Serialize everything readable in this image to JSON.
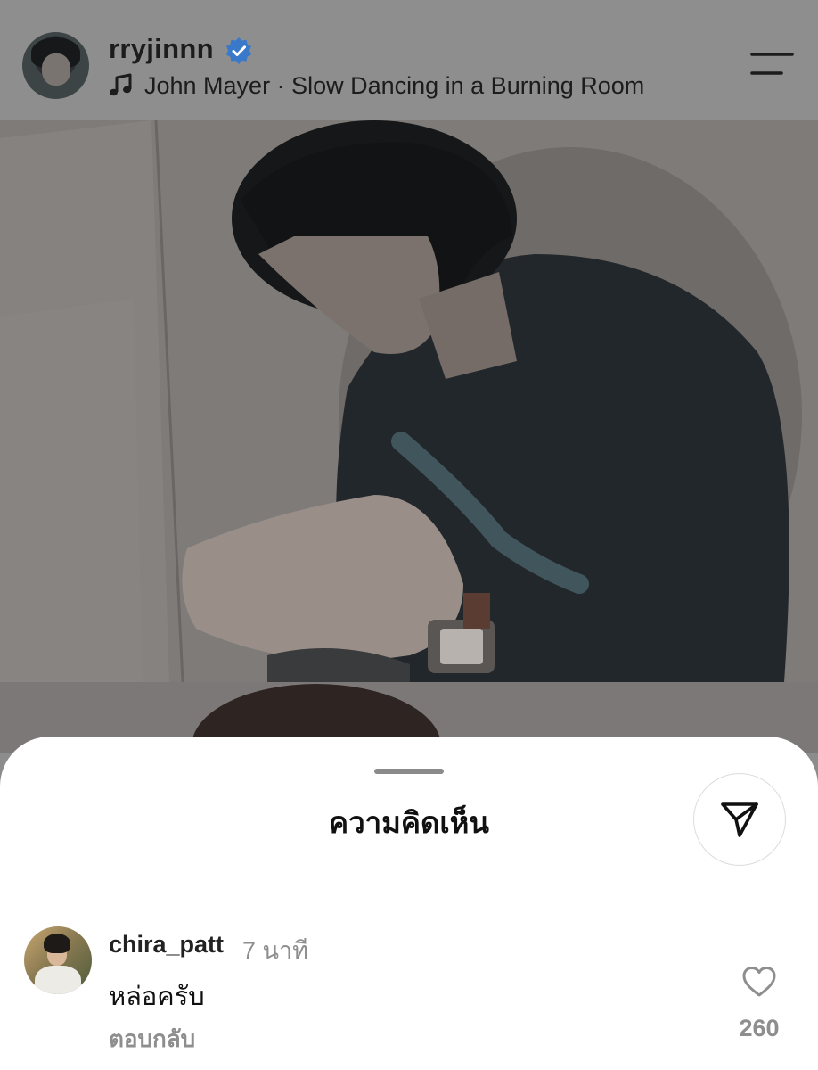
{
  "post_header": {
    "username": "rryjinnn",
    "verified_icon": "verified-badge-icon",
    "music_icon": "music-note-icon",
    "song": "John Mayer · Slow Dancing in a Burning Room",
    "menu_icon": "menu-icon"
  },
  "comments_sheet": {
    "title": "ความคิดเห็น",
    "share_icon": "send-icon",
    "comments": [
      {
        "username": "chira_patt",
        "time": "7 นาที",
        "text": "หล่อครับ",
        "reply_label": "ตอบกลับ",
        "like_count": "260"
      }
    ]
  },
  "colors": {
    "verified": "#3a78c9",
    "muted_text": "#8e8e8e"
  }
}
